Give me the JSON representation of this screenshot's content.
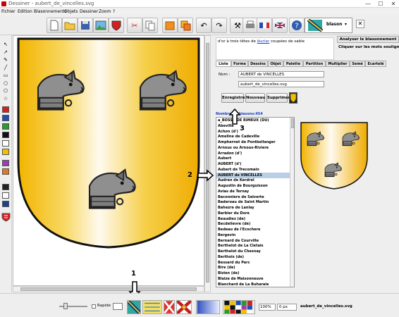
{
  "window": {
    "title": "Dessiner - aubert_de_vincelles.svg",
    "controls": {
      "minimize": "—",
      "maximize": "☐",
      "close": "✕"
    }
  },
  "menu": [
    "Fichier",
    "Edition",
    "Blasonnements",
    "Objets",
    "Dessiner",
    "Zoom",
    "?"
  ],
  "toolbar": {
    "blason_label": "blason",
    "combo_arrow": "▾",
    "close_x": "✕"
  },
  "colors": {
    "shield_gold_light": "#fffaf0",
    "shield_gold_dark": "#f0b000",
    "greyhound": "#8f8f8f",
    "selection": "#b8cfe5",
    "link": "#1b3fbf"
  },
  "description": {
    "pre": "d'or à trois têtes de ",
    "link": "lévrier",
    "post": " coupées de sable"
  },
  "analyze_button": "Analyser le blasonnement",
  "click_hint": "Cliquer sur les mots soulignés",
  "tabs": [
    "Liste",
    "Forme",
    "Dessins",
    "Objet",
    "Palette",
    "Partition",
    "Multiplier",
    "Semé",
    "Ecartelé"
  ],
  "form": {
    "nom_label": "Nom :",
    "nom_value": "AUBERT de VINCELLES",
    "file_value": "aubert_de_vincelles.svg"
  },
  "buttons": {
    "save": "Enregistrer",
    "new": "Nouveau",
    "delete": "Supprimer"
  },
  "count_label": "Nombre de blasons:454",
  "list": {
    "items": [
      "a_BOSSU DE RIMEUX (DU)",
      "Abeville",
      "Achon (d')",
      "Ameline de Cadeville",
      "Amphernet de Pontbellanger",
      "Arnous ou Arnous-Riviere",
      "Arradon (d')",
      "Aubert",
      "AUBERT (d')",
      "Aubert de Trecomain",
      "AUBERT de VINCELLES",
      "Audren de Kerdrel",
      "Augustin de Bourguisson",
      "Avias de Ternay",
      "Baconniere de Salverte",
      "Baderoau de Saint Martin",
      "Bahezre de Lanlay",
      "Barbier du Dore",
      "Beaudiez (de)",
      "Becdelievre (de)",
      "Bedeau de l'Ecochere",
      "Bergevin",
      "Bernard de Courville",
      "Berthelot de La Cletais",
      "Berthelot du Chesnay",
      "Berthois (de)",
      "Bessard du Parc",
      "Bire (de)",
      "Bizien (de)",
      "Blaize de Maisonneuve",
      "Blanchard de La Buharaie"
    ],
    "selected_index": 10
  },
  "annotations": [
    "1",
    "2",
    "3"
  ],
  "bottom": {
    "rapide_label": "Rapide",
    "zoom_value": "100%",
    "px_value": "0 px",
    "filename": "aubert_de_vincelles.svg"
  }
}
